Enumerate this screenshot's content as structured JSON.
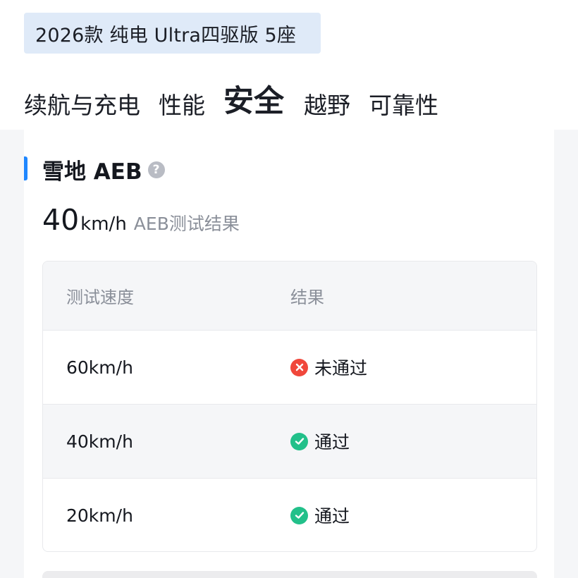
{
  "header": {
    "model_name": "2026款 纯电 Ultra四驱版 5座"
  },
  "tabs": [
    {
      "label": "续航与充电",
      "active": false
    },
    {
      "label": "性能",
      "active": false
    },
    {
      "label": "安全",
      "active": true
    },
    {
      "label": "越野",
      "active": false
    },
    {
      "label": "可靠性",
      "active": false
    }
  ],
  "section": {
    "title": "雪地 AEB",
    "help_icon": "question-circle-icon",
    "result_value": "40",
    "result_unit": "km/h",
    "result_caption": "AEB测试结果"
  },
  "table": {
    "headers": {
      "speed": "测试速度",
      "result": "结果"
    },
    "rows": [
      {
        "speed": "60km/h",
        "result": "未通过",
        "status": "fail"
      },
      {
        "speed": "40km/h",
        "result": "通过",
        "status": "pass"
      },
      {
        "speed": "20km/h",
        "result": "通过",
        "status": "pass"
      }
    ]
  },
  "colors": {
    "accent": "#1f87ff",
    "pass": "#22c08a",
    "fail": "#f0473b",
    "chip_bg": "#dfeaf8"
  }
}
